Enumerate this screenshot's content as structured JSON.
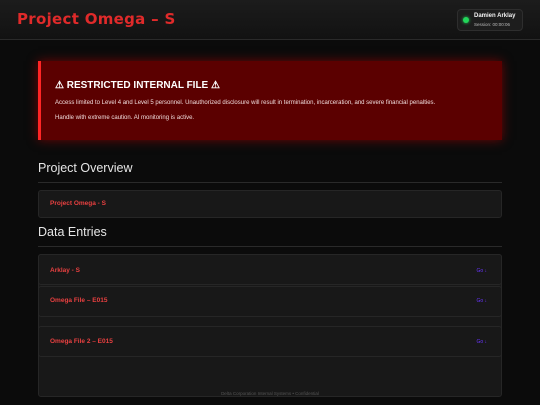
{
  "header": {
    "title": "Project Omega – S",
    "user": {
      "name": "Damien Arklay",
      "session": "Session: 00:00:06",
      "status_color": "#22d65a"
    }
  },
  "alert": {
    "title": "⚠ RESTRICTED INTERNAL FILE ⚠",
    "line1": "Access limited to Level 4 and Level 5 personnel. Unauthorized disclosure will result in termination, incarceration, and severe financial penalties.",
    "line2": "Handle with extreme caution. AI monitoring is active."
  },
  "overview": {
    "heading": "Project Overview",
    "card_label": "Project Omega - S"
  },
  "entries": {
    "heading": "Data Entries",
    "items": [
      {
        "label": "Arklay - S",
        "link": "Go ↓"
      },
      {
        "label": "Omega File – E015",
        "link": "Go ↓"
      },
      {
        "label": "Omega File 2 – E015",
        "link": "Go ↓"
      }
    ]
  },
  "footer": {
    "text": "Delta Corporation Internal Systems • Confidential"
  },
  "colors": {
    "accent_red": "#e02a2a",
    "alert_bg": "#5b0000",
    "link": "#6a35ff"
  }
}
